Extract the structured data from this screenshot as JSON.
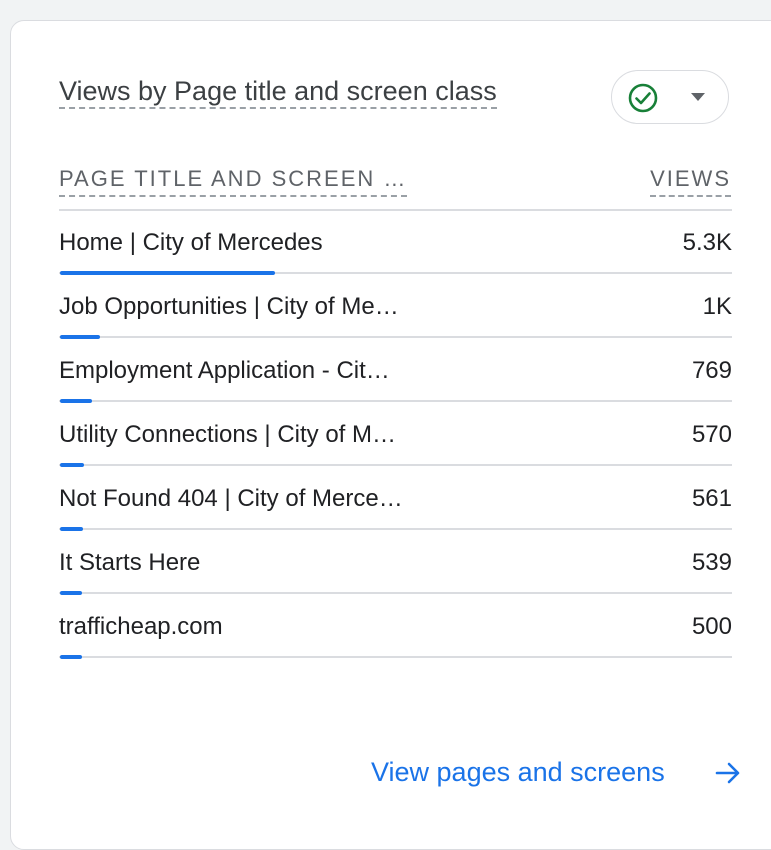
{
  "card": {
    "title": "Views by Page title and screen class",
    "status_icon": "check-circle-icon",
    "dropdown_icon": "caret-down-icon"
  },
  "table": {
    "columns": [
      "PAGE TITLE AND SCREEN …",
      "VIEWS"
    ],
    "rows": [
      {
        "title": "Home | City of Mercedes",
        "views": "5.3K",
        "share": 0.32
      },
      {
        "title": "Job Opportunities | City of Me…",
        "views": "1K",
        "share": 0.06
      },
      {
        "title": "Employment Application - Cit…",
        "views": "769",
        "share": 0.047
      },
      {
        "title": "Utility Connections | City of M…",
        "views": "570",
        "share": 0.035
      },
      {
        "title": "Not Found 404 | City of Merce…",
        "views": "561",
        "share": 0.034
      },
      {
        "title": "It Starts Here",
        "views": "539",
        "share": 0.033
      },
      {
        "title": "trafficheap.com",
        "views": "500",
        "share": 0.03
      }
    ]
  },
  "footer": {
    "link_label": "View pages and screens",
    "link_icon": "arrow-right-icon"
  },
  "colors": {
    "accent": "#1a73e8",
    "success": "#188038",
    "divider": "#dadce0"
  }
}
